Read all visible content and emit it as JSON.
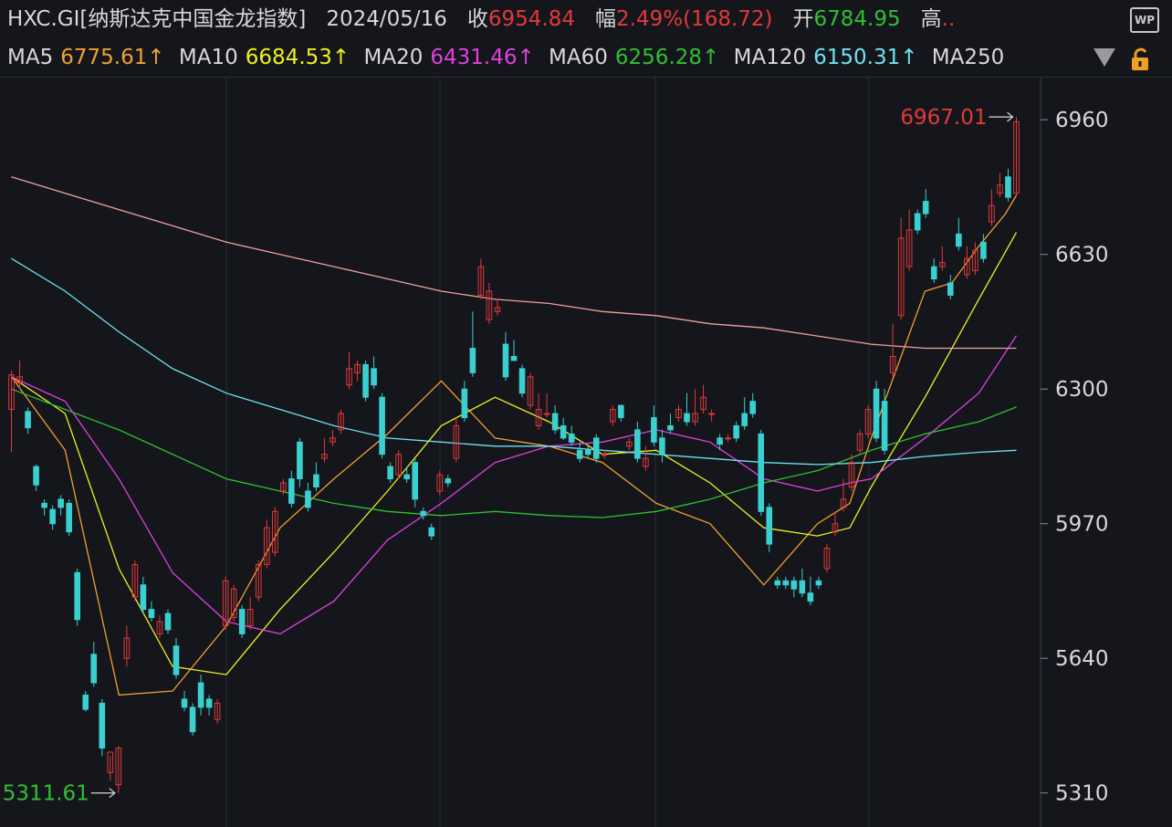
{
  "header": {
    "code": "HXC.GI[纳斯达克中国金龙指数]",
    "date": "2024/05/16",
    "close_label": "收",
    "close_value": "6954.84",
    "change_label": "幅",
    "change_value": "2.49%(168.72)",
    "open_label": "开",
    "open_value": "6784.95",
    "high_label": "高",
    "high_value": "..",
    "wp_label": "WP"
  },
  "ma_legend": [
    {
      "label": "MA5",
      "value": "6775.61↑",
      "color": "#f0a030"
    },
    {
      "label": "MA10",
      "value": "6684.53↑",
      "color": "#f0f020"
    },
    {
      "label": "MA20",
      "value": "6431.46↑",
      "color": "#e040e0"
    },
    {
      "label": "MA60",
      "value": "6256.28↑",
      "color": "#30c030"
    },
    {
      "label": "MA120",
      "value": "6150.31↑",
      "color": "#70e0f0"
    },
    {
      "label": "MA250",
      "value": "",
      "color": "#f0a0a0"
    }
  ],
  "icons": {
    "dropdown": "triangle-down-icon",
    "lock": "lock-icon"
  },
  "colors": {
    "up": "#e03a3a",
    "down": "#3ad0d0",
    "bg": "#14161c",
    "axis_text": "#d8d8d8",
    "grid": "#2a2d35"
  },
  "chart_data": {
    "type": "candlestick",
    "ylim": [
      5240,
      7050
    ],
    "yticks": [
      6960,
      6630,
      6300,
      5970,
      5640,
      5310
    ],
    "max_label": "6967.01",
    "min_label": "5311.61",
    "candles": [
      [
        6250,
        6335,
        6145,
        6345
      ],
      [
        6315,
        6330,
        6300,
        6370
      ],
      [
        6245,
        6205,
        6190,
        6255
      ],
      [
        6110,
        6065,
        6050,
        6115
      ],
      [
        6020,
        6010,
        5990,
        6030
      ],
      [
        6005,
        5970,
        5955,
        6015
      ],
      [
        6030,
        6010,
        5990,
        6040
      ],
      [
        6020,
        5950,
        5940,
        6030
      ],
      [
        5850,
        5735,
        5720,
        5860
      ],
      [
        5550,
        5515,
        5510,
        5560
      ],
      [
        5650,
        5580,
        5570,
        5680
      ],
      [
        5530,
        5420,
        5400,
        5540
      ],
      [
        5360,
        5410,
        5340,
        5400
      ],
      [
        5330,
        5420,
        5310,
        5425
      ],
      [
        5640,
        5690,
        5620,
        5720
      ],
      [
        5790,
        5870,
        5780,
        5880
      ],
      [
        5820,
        5760,
        5750,
        5840
      ],
      [
        5760,
        5740,
        5730,
        5780
      ],
      [
        5700,
        5730,
        5690,
        5745
      ],
      [
        5750,
        5710,
        5700,
        5760
      ],
      [
        5670,
        5600,
        5590,
        5690
      ],
      [
        5540,
        5520,
        5510,
        5560
      ],
      [
        5520,
        5460,
        5450,
        5530
      ],
      [
        5580,
        5520,
        5500,
        5600
      ],
      [
        5540,
        5520,
        5500,
        5550
      ],
      [
        5490,
        5530,
        5480,
        5540
      ],
      [
        5720,
        5830,
        5710,
        5840
      ],
      [
        5740,
        5810,
        5730,
        5820
      ],
      [
        5760,
        5700,
        5690,
        5770
      ],
      [
        5720,
        5760,
        5710,
        5790
      ],
      [
        5790,
        5870,
        5780,
        5880
      ],
      [
        5870,
        5960,
        5860,
        5980
      ],
      [
        5900,
        6000,
        5890,
        6010
      ],
      [
        6050,
        6070,
        6040,
        6080
      ],
      [
        6080,
        6020,
        6010,
        6100
      ],
      [
        6170,
        6080,
        6060,
        6180
      ],
      [
        6050,
        6010,
        6000,
        6070
      ],
      [
        6090,
        6060,
        6050,
        6120
      ],
      [
        6130,
        6140,
        6120,
        6180
      ],
      [
        6170,
        6180,
        6160,
        6200
      ],
      [
        6200,
        6240,
        6190,
        6250
      ],
      [
        6310,
        6350,
        6300,
        6390
      ],
      [
        6340,
        6360,
        6320,
        6370
      ],
      [
        6360,
        6280,
        6270,
        6370
      ],
      [
        6350,
        6310,
        6300,
        6380
      ],
      [
        6280,
        6140,
        6130,
        6290
      ],
      [
        6110,
        6080,
        6070,
        6120
      ],
      [
        6090,
        6140,
        6080,
        6150
      ],
      [
        6090,
        6080,
        6070,
        6110
      ],
      [
        6120,
        6030,
        6010,
        6130
      ],
      [
        6000,
        5990,
        5980,
        6010
      ],
      [
        5960,
        5940,
        5930,
        5970
      ],
      [
        6050,
        6090,
        6040,
        6100
      ],
      [
        6080,
        6070,
        6060,
        6090
      ],
      [
        6130,
        6210,
        6120,
        6230
      ],
      [
        6300,
        6230,
        6220,
        6320
      ],
      [
        6400,
        6340,
        6330,
        6490
      ],
      [
        6530,
        6600,
        6520,
        6620
      ],
      [
        6470,
        6540,
        6460,
        6560
      ],
      [
        6490,
        6500,
        6480,
        6520
      ],
      [
        6410,
        6330,
        6320,
        6440
      ],
      [
        6380,
        6370,
        6370,
        6420
      ],
      [
        6350,
        6290,
        6280,
        6360
      ],
      [
        6260,
        6330,
        6250,
        6340
      ],
      [
        6210,
        6250,
        6200,
        6290
      ],
      [
        6240,
        6240,
        6230,
        6290
      ],
      [
        6240,
        6200,
        6190,
        6260
      ],
      [
        6210,
        6180,
        6175,
        6230
      ],
      [
        6190,
        6170,
        6160,
        6210
      ],
      [
        6150,
        6130,
        6120,
        6170
      ],
      [
        6150,
        6140,
        6130,
        6160
      ],
      [
        6180,
        6130,
        6120,
        6190
      ],
      [
        6140,
        6140,
        6130,
        6150
      ],
      [
        6220,
        6250,
        6210,
        6260
      ],
      [
        6260,
        6230,
        6220,
        6260
      ],
      [
        6160,
        6170,
        6150,
        6180
      ],
      [
        6200,
        6130,
        6120,
        6220
      ],
      [
        6110,
        6130,
        6100,
        6160
      ],
      [
        6230,
        6170,
        6160,
        6260
      ],
      [
        6180,
        6140,
        6120,
        6200
      ],
      [
        6210,
        6200,
        6190,
        6240
      ],
      [
        6230,
        6250,
        6220,
        6260
      ],
      [
        6240,
        6220,
        6210,
        6290
      ],
      [
        6220,
        6240,
        6210,
        6300
      ],
      [
        6250,
        6280,
        6240,
        6310
      ],
      [
        6240,
        6240,
        6220,
        6250
      ],
      [
        6180,
        6165,
        6150,
        6190
      ],
      [
        6180,
        6180,
        6170,
        6190
      ],
      [
        6210,
        6180,
        6170,
        6220
      ],
      [
        6240,
        6210,
        6200,
        6280
      ],
      [
        6270,
        6240,
        6230,
        6290
      ],
      [
        6190,
        6000,
        5990,
        6200
      ],
      [
        6010,
        5920,
        5900,
        6020
      ],
      [
        5830,
        5820,
        5810,
        5840
      ],
      [
        5830,
        5820,
        5810,
        5840
      ],
      [
        5830,
        5810,
        5790,
        5840
      ],
      [
        5830,
        5800,
        5790,
        5860
      ],
      [
        5800,
        5780,
        5770,
        5840
      ],
      [
        5830,
        5820,
        5810,
        5840
      ],
      [
        5860,
        5910,
        5850,
        5920
      ],
      [
        5950,
        5970,
        5940,
        6000
      ],
      [
        6010,
        6030,
        6000,
        6080
      ],
      [
        6060,
        6120,
        6050,
        6140
      ],
      [
        6150,
        6190,
        6140,
        6200
      ],
      [
        6190,
        6250,
        6180,
        6260
      ],
      [
        6300,
        6180,
        6170,
        6320
      ],
      [
        6270,
        6150,
        6140,
        6300
      ],
      [
        6340,
        6380,
        6330,
        6460
      ],
      [
        6480,
        6670,
        6470,
        6720
      ],
      [
        6600,
        6690,
        6590,
        6740
      ],
      [
        6730,
        6690,
        6680,
        6740
      ],
      [
        6760,
        6730,
        6720,
        6790
      ],
      [
        6600,
        6570,
        6560,
        6620
      ],
      [
        6600,
        6610,
        6590,
        6650
      ],
      [
        6560,
        6530,
        6520,
        6580
      ],
      [
        6680,
        6650,
        6640,
        6720
      ],
      [
        6580,
        6620,
        6570,
        6650
      ],
      [
        6590,
        6640,
        6580,
        6660
      ],
      [
        6660,
        6620,
        6610,
        6680
      ],
      [
        6710,
        6750,
        6700,
        6790
      ],
      [
        6780,
        6800,
        6770,
        6830
      ],
      [
        6820,
        6770,
        6760,
        6840
      ],
      [
        6780,
        6955,
        6775,
        6967
      ]
    ],
    "ma_series": {
      "MA5": [
        [
          0,
          6330
        ],
        [
          10,
          6150
        ],
        [
          20,
          5550
        ],
        [
          30,
          5560
        ],
        [
          40,
          5720
        ],
        [
          50,
          5960
        ],
        [
          60,
          6080
        ],
        [
          70,
          6190
        ],
        [
          80,
          6320
        ],
        [
          90,
          6180
        ],
        [
          100,
          6160
        ],
        [
          110,
          6120
        ],
        [
          120,
          6020
        ],
        [
          130,
          5970
        ],
        [
          136,
          5880
        ],
        [
          140,
          5820
        ],
        [
          150,
          5970
        ],
        [
          156,
          6020
        ],
        [
          160,
          6180
        ],
        [
          170,
          6540
        ],
        [
          175,
          6560
        ],
        [
          180,
          6650
        ],
        [
          185,
          6730
        ],
        [
          187,
          6775
        ]
      ],
      "MA10": [
        [
          0,
          6330
        ],
        [
          10,
          6240
        ],
        [
          20,
          5860
        ],
        [
          30,
          5620
        ],
        [
          40,
          5600
        ],
        [
          50,
          5760
        ],
        [
          60,
          5900
        ],
        [
          70,
          6050
        ],
        [
          80,
          6210
        ],
        [
          90,
          6280
        ],
        [
          100,
          6220
        ],
        [
          110,
          6140
        ],
        [
          120,
          6150
        ],
        [
          130,
          6070
        ],
        [
          140,
          5960
        ],
        [
          150,
          5940
        ],
        [
          156,
          5960
        ],
        [
          160,
          6060
        ],
        [
          170,
          6280
        ],
        [
          180,
          6520
        ],
        [
          187,
          6684
        ]
      ],
      "MA20": [
        [
          0,
          6330
        ],
        [
          10,
          6270
        ],
        [
          20,
          6080
        ],
        [
          30,
          5850
        ],
        [
          40,
          5730
        ],
        [
          50,
          5700
        ],
        [
          60,
          5780
        ],
        [
          70,
          5930
        ],
        [
          80,
          6020
        ],
        [
          90,
          6120
        ],
        [
          100,
          6160
        ],
        [
          110,
          6170
        ],
        [
          120,
          6200
        ],
        [
          130,
          6170
        ],
        [
          140,
          6080
        ],
        [
          150,
          6050
        ],
        [
          156,
          6070
        ],
        [
          160,
          6080
        ],
        [
          170,
          6180
        ],
        [
          180,
          6290
        ],
        [
          187,
          6431
        ]
      ],
      "MA60": [
        [
          0,
          6300
        ],
        [
          20,
          6200
        ],
        [
          40,
          6080
        ],
        [
          60,
          6020
        ],
        [
          70,
          6000
        ],
        [
          80,
          5990
        ],
        [
          90,
          6000
        ],
        [
          100,
          5990
        ],
        [
          110,
          5985
        ],
        [
          120,
          6000
        ],
        [
          130,
          6030
        ],
        [
          140,
          6070
        ],
        [
          150,
          6100
        ],
        [
          160,
          6150
        ],
        [
          170,
          6190
        ],
        [
          180,
          6220
        ],
        [
          187,
          6256
        ]
      ],
      "MA120": [
        [
          0,
          6620
        ],
        [
          10,
          6540
        ],
        [
          20,
          6440
        ],
        [
          30,
          6350
        ],
        [
          40,
          6290
        ],
        [
          50,
          6250
        ],
        [
          60,
          6210
        ],
        [
          70,
          6180
        ],
        [
          80,
          6170
        ],
        [
          90,
          6160
        ],
        [
          100,
          6160
        ],
        [
          110,
          6150
        ],
        [
          120,
          6140
        ],
        [
          130,
          6130
        ],
        [
          140,
          6120
        ],
        [
          150,
          6115
        ],
        [
          160,
          6120
        ],
        [
          170,
          6135
        ],
        [
          180,
          6145
        ],
        [
          187,
          6150
        ]
      ],
      "MA250": [
        [
          0,
          6820
        ],
        [
          10,
          6780
        ],
        [
          20,
          6740
        ],
        [
          30,
          6700
        ],
        [
          40,
          6660
        ],
        [
          50,
          6630
        ],
        [
          60,
          6600
        ],
        [
          70,
          6570
        ],
        [
          80,
          6540
        ],
        [
          90,
          6520
        ],
        [
          100,
          6510
        ],
        [
          110,
          6490
        ],
        [
          120,
          6480
        ],
        [
          130,
          6460
        ],
        [
          140,
          6450
        ],
        [
          150,
          6430
        ],
        [
          160,
          6410
        ],
        [
          170,
          6400
        ],
        [
          180,
          6400
        ],
        [
          187,
          6400
        ]
      ]
    }
  }
}
